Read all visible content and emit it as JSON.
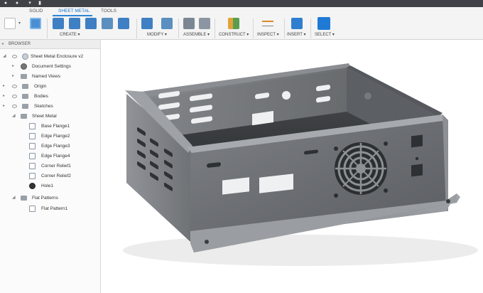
{
  "tabs": [
    {
      "label": "SOLID",
      "active": false
    },
    {
      "label": "SHEET METAL",
      "active": true
    },
    {
      "label": "TOOLS",
      "active": false
    }
  ],
  "ribbon": {
    "create": "CREATE ▾",
    "modify": "MODIFY ▾",
    "assemble": "ASSEMBLE ▾",
    "construct": "CONSTRUCT ▾",
    "inspect": "INSPECT ▾",
    "insert": "INSERT ▾",
    "select": "SELECT ▾"
  },
  "browser": {
    "title": "BROWSER",
    "root": "Sheet Metal Enclosure v2",
    "items": [
      {
        "label": "Document Settings"
      },
      {
        "label": "Named Views"
      },
      {
        "label": "Origin"
      },
      {
        "label": "Bodies"
      },
      {
        "label": "Sketches"
      },
      {
        "label": "Sheet Metal"
      },
      {
        "label": "Base Flange1"
      },
      {
        "label": "Edge Flange2"
      },
      {
        "label": "Edge Flange3"
      },
      {
        "label": "Edge Flange4"
      },
      {
        "label": "Corner Relief1"
      },
      {
        "label": "Corner Relief2"
      },
      {
        "label": "Hole1"
      },
      {
        "label": "Flat Patterns"
      },
      {
        "label": "Flat Pattern1"
      }
    ]
  },
  "colors": {
    "accent": "#2b86d7",
    "ribbon_bg": "#f4f4f4",
    "titlebar": "#3f4246"
  }
}
